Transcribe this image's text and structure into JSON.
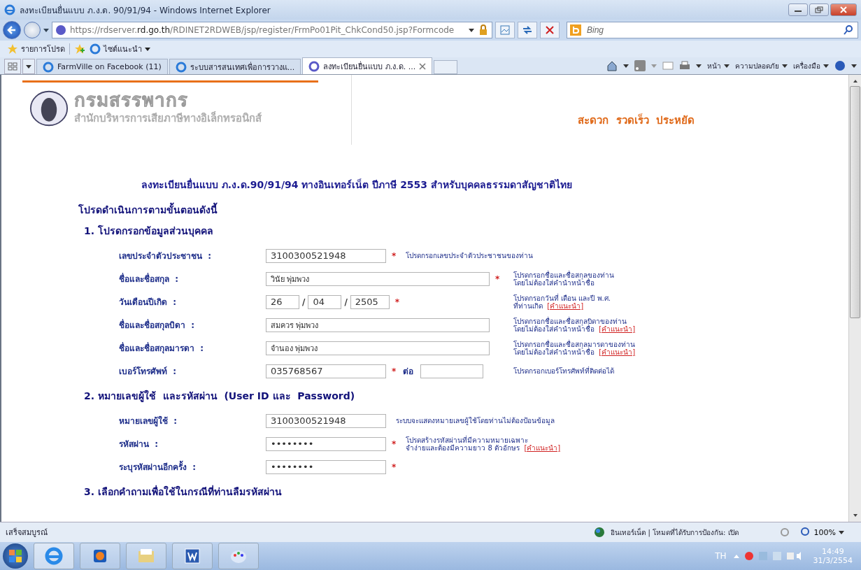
{
  "window": {
    "title": "ลงทะเบียนยื่นแบบ ภ.ง.ด. 90/91/94 - Windows Internet Explorer"
  },
  "address_bar": {
    "url_host_pre": "https://rdserver.",
    "url_host": "rd.go.th",
    "url_path": "/RDINET2RDWEB/jsp/register/FrmPo01Pit_ChkCond50.jsp?Formcode"
  },
  "search": {
    "placeholder": "Bing"
  },
  "favorites_bar": {
    "favorites": "รายการโปรด",
    "suggested": "ไซต์แนะนำ"
  },
  "tabs": [
    {
      "label": "FarmVille on Facebook (11)",
      "selected": false
    },
    {
      "label": "ระบบสารสนเทศเพื่อการวางแ...",
      "selected": false
    },
    {
      "label": "ลงทะเบียนยื่นแบบ ภ.ง.ด. ...",
      "selected": true
    }
  ],
  "command_menus": [
    "หน้า",
    "ความปลอดภัย",
    "เครื่องมือ"
  ],
  "page": {
    "logo_title": "กรมสรรพากร",
    "logo_subtitle": "สำนักบริหารการเสียภาษีทางอิเล็กทรอนิกส์",
    "slogan": "สะดวก  รวดเร็ว  ประหยัด",
    "heading": "ลงทะเบียนยื่นแบบ ภ.ง.ด.90/91/94 ทางอินเทอร์เน็ต ปีภาษี 2553 สำหรับบุคคลธรรมดาสัญชาติไทย",
    "intro": "โปรดดำเนินการตามขั้นตอนดังนี้",
    "sections": [
      {
        "title": "1. โปรดกรอกข้อมูลส่วนบุคคล",
        "fields": [
          {
            "kind": "short",
            "label": "เลขประจำตัวประชาชน  :",
            "values": [
              "3100300521948"
            ],
            "required_mark": "*",
            "hint": [
              "โปรดกรอกเลขประจำตัวประชาชนของท่าน"
            ]
          },
          {
            "kind": "wide",
            "label": "ชื่อและชื่อสกุล  :",
            "values": [
              "วินัย พุ่มพวง"
            ],
            "required_mark": "*",
            "hint": [
              "โปรดกรอกชื่อและชื่อสกุลของท่าน",
              "โดยไม่ต้องใส่คำนำหน้าชื่อ"
            ]
          },
          {
            "kind": "date",
            "label": "วันเดือนปีเกิด  :",
            "values": [
              "26",
              "04",
              "2505"
            ],
            "separator": "/",
            "required_mark": "*",
            "hint": [
              "โปรดกรอกวันที่  เดือน  และปี  พ.ศ.",
              "ที่ท่านเกิด"
            ],
            "link": "[คำแนะนำ]"
          },
          {
            "kind": "wide",
            "label": "ชื่อและชื่อสกุลบิดา  :",
            "values": [
              "สมควร พุ่มพวง"
            ],
            "hint": [
              "โปรดกรอกชื่อและชื่อสกุลบิดาของท่าน",
              "โดยไม่ต้องใส่คำนำหน้าชื่อ"
            ],
            "link": "[คำแนะนำ]"
          },
          {
            "kind": "wide",
            "label": "ชื่อและชื่อสกุลมารดา  :",
            "values": [
              "จำนอง พุ่มพวง"
            ],
            "hint": [
              "โปรดกรอกชื่อและชื่อสกุลมารดาของท่าน",
              "โดยไม่ต้องใส่คำนำหน้าชื่อ"
            ],
            "link": "[คำแนะนำ]"
          },
          {
            "kind": "phone",
            "label": "เบอร์โทรศัพท์  :",
            "values": [
              "035768567"
            ],
            "required_mark": "*",
            "extension_label": "ต่อ",
            "hint": [
              "โปรดกรอกเบอร์โทรศัพท์ที่ติดต่อได้"
            ]
          }
        ]
      },
      {
        "title": "2. หมายเลขผู้ใช้  และรหัสผ่าน  (User ID และ  Password)",
        "fields": [
          {
            "kind": "short",
            "label": "หมายเลขผู้ใช้  :",
            "values": [
              "3100300521948"
            ],
            "hint": [
              "ระบบจะแสดงหมายเลขผู้ใช้โดยท่านไม่ต้องป้อนข้อมูล"
            ]
          },
          {
            "kind": "short",
            "label": "รหัสผ่าน  :",
            "values": [
              "••••••••"
            ],
            "required_mark": "*",
            "hint": [
              "โปรดสร้างรหัสผ่านที่มีความหมายเฉพาะ",
              "จำง่ายและต้องมีความยาว  8 ตัวอักษร"
            ],
            "link": "[คำแนะนำ]"
          },
          {
            "kind": "short",
            "label": "ระบุรหัสผ่านอีกครั้ง  :",
            "values": [
              "••••••••"
            ],
            "required_mark": "*"
          }
        ]
      },
      {
        "title": "3. เลือกคำถามเพื่อใช้ในกรณีที่ท่านลืมรหัสผ่าน"
      }
    ]
  },
  "status_bar": {
    "text": "เสร็จสมบูรณ์",
    "zone": "อินเทอร์เน็ต | โหมดที่ได้รับการป้องกัน: เปิด",
    "zoom": "100%"
  },
  "taskbar": {
    "language": "TH",
    "time": "14:49",
    "date": "31/3/2554"
  }
}
